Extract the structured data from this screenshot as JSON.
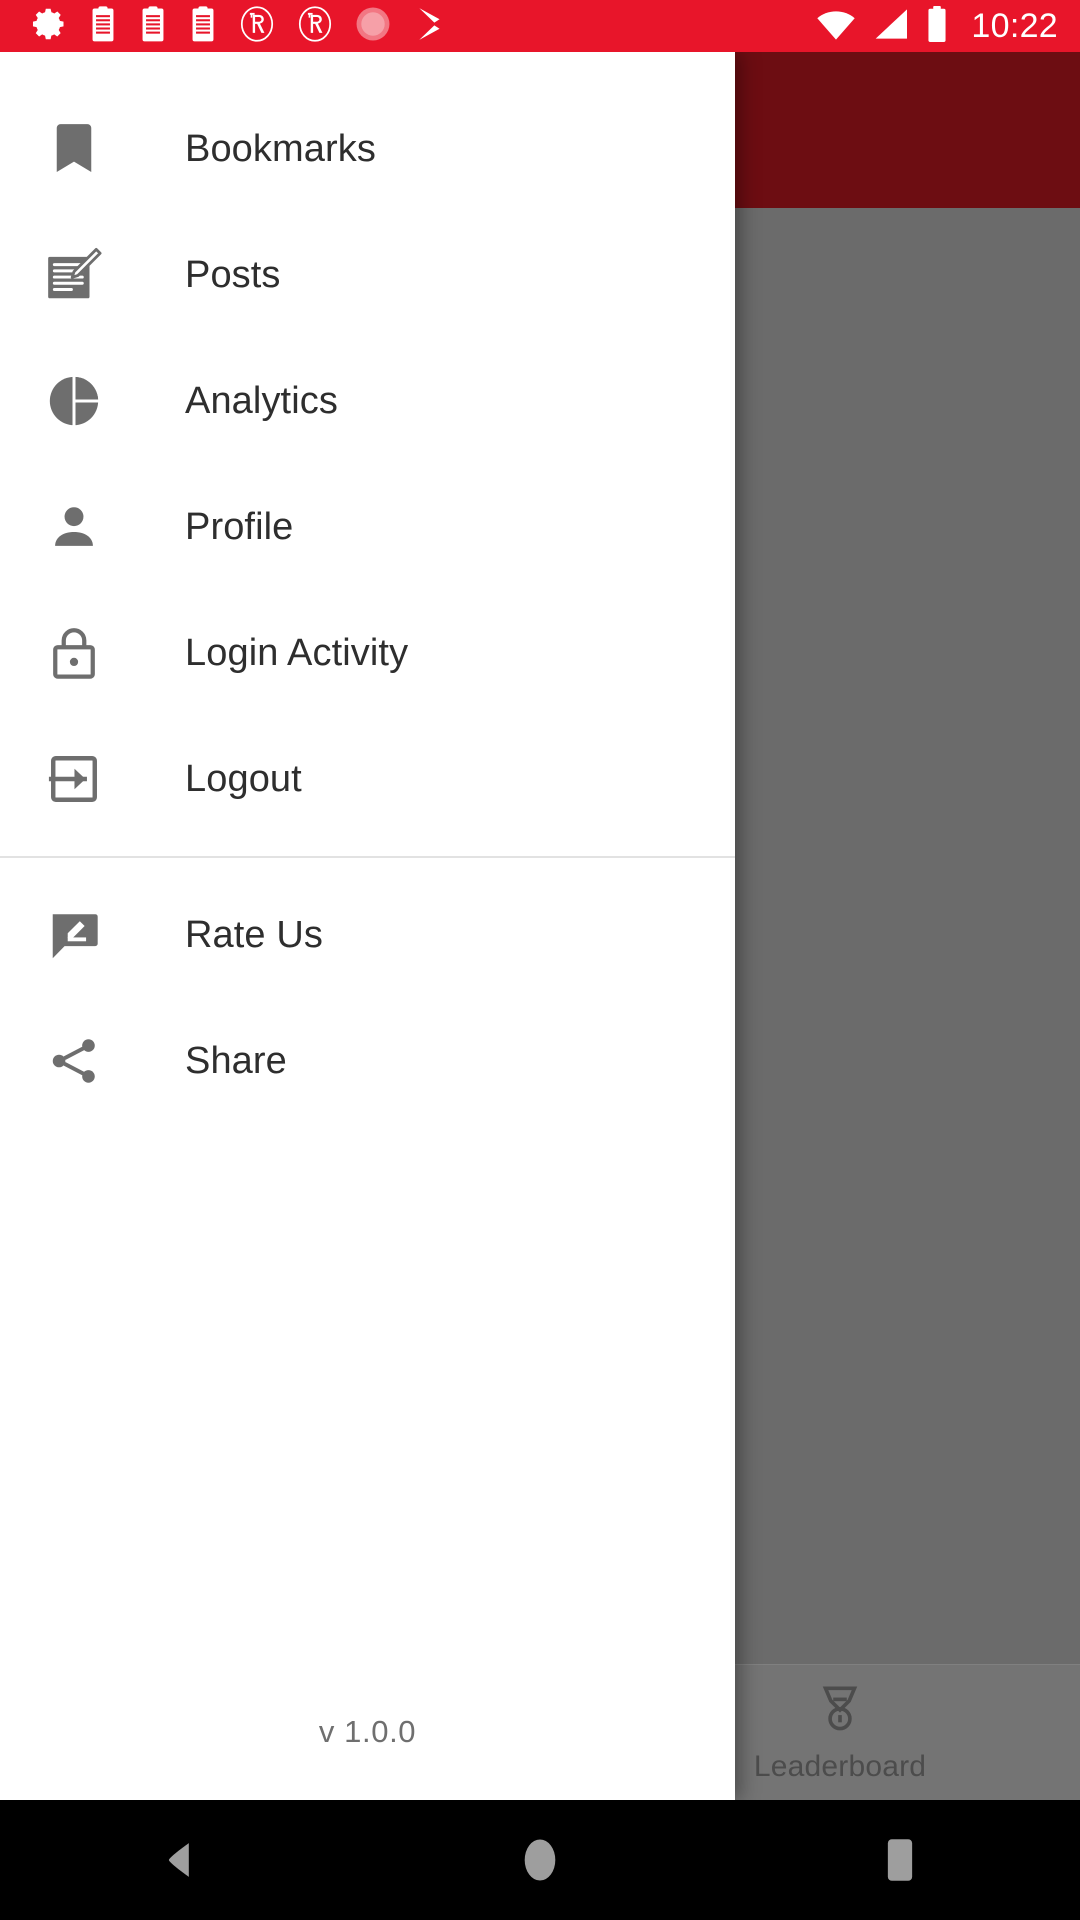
{
  "status_bar": {
    "background_color": "#e8152a",
    "left_icons": [
      {
        "name": "settings-gear-icon"
      },
      {
        "name": "clipboard-icon-1"
      },
      {
        "name": "clipboard-icon-2"
      },
      {
        "name": "clipboard-icon-3"
      },
      {
        "name": "circled-r-icon-1"
      },
      {
        "name": "circled-r-icon-2"
      },
      {
        "name": "recording-dot-icon"
      },
      {
        "name": "play-store-icon"
      }
    ],
    "right_icons": [
      {
        "name": "wifi-icon"
      },
      {
        "name": "cellular-signal-icon"
      },
      {
        "name": "battery-icon"
      }
    ],
    "clock": "10:22"
  },
  "drawer": {
    "background_color": "#ffffff",
    "icon_color": "#6e6e6e",
    "text_color": "#2e2e2e",
    "primary_items": [
      {
        "label": "Bookmarks",
        "icon": "bookmark-icon"
      },
      {
        "label": "Posts",
        "icon": "post-edit-icon"
      },
      {
        "label": "Analytics",
        "icon": "pie-chart-icon"
      },
      {
        "label": "Profile",
        "icon": "person-icon"
      },
      {
        "label": "Login Activity",
        "icon": "lock-icon"
      },
      {
        "label": "Logout",
        "icon": "exit-arrow-icon"
      }
    ],
    "secondary_items": [
      {
        "label": "Rate Us",
        "icon": "rate-review-icon"
      },
      {
        "label": "Share",
        "icon": "share-icon"
      }
    ],
    "version": "v 1.0.0"
  },
  "backdrop": {
    "toolbar_color": "#6d0d12",
    "scrim_color": "#6b6b6b",
    "bottom_tabs": [
      {
        "label": "Leaderboard",
        "icon": "medal-icon"
      }
    ]
  },
  "nav_bar": {
    "background_color": "#000000",
    "buttons": [
      {
        "name": "back-button",
        "icon": "triangle-back-icon"
      },
      {
        "name": "home-button",
        "icon": "circle-home-icon"
      },
      {
        "name": "recents-button",
        "icon": "square-recents-icon"
      }
    ]
  }
}
